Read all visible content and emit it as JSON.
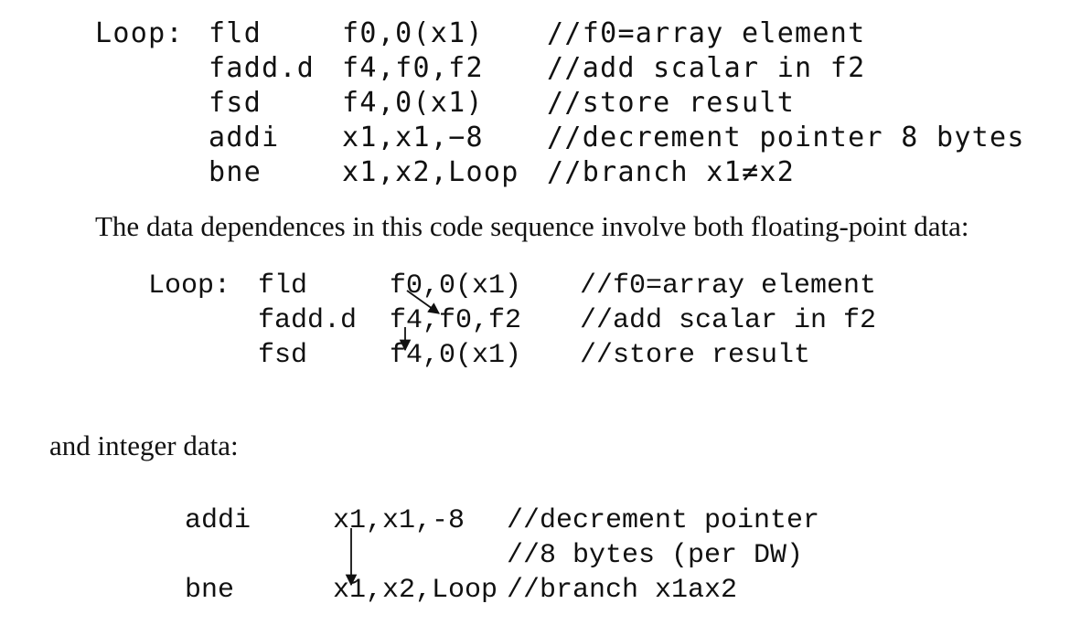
{
  "listing1": [
    {
      "label": "Loop:",
      "op": "fld",
      "args": "f0,0(x1)",
      "comment": "//f0=array element"
    },
    {
      "label": "",
      "op": "fadd.d",
      "args": "f4,f0,f2",
      "comment": "//add scalar in f2"
    },
    {
      "label": "",
      "op": "fsd",
      "args": "f4,0(x1)",
      "comment": "//store result"
    },
    {
      "label": "",
      "op": "addi",
      "args": "x1,x1,−8",
      "comment": "//decrement pointer 8 bytes"
    },
    {
      "label": "",
      "op": "bne",
      "args": "x1,x2,Loop",
      "comment": "//branch x1≠x2"
    }
  ],
  "sentence_fp": "The data dependences in this code sequence involve both floating-point data:",
  "listing2": [
    {
      "label": "Loop:",
      "op": "fld",
      "args": "f0,0(x1)",
      "comment": "//f0=array element"
    },
    {
      "label": "",
      "op": "fadd.d",
      "args": "f4,f0,f2",
      "comment": "//add scalar in f2"
    },
    {
      "label": "",
      "op": "fsd",
      "args": "f4,0(x1)",
      "comment": "//store result"
    }
  ],
  "sentence_int": "and integer data:",
  "listing3": [
    {
      "op": "addi",
      "args": "x1,x1,-8",
      "comment": "//decrement pointer"
    },
    {
      "op": "",
      "args": "",
      "comment": "//8 bytes (per DW)"
    },
    {
      "op": "bne",
      "args": "x1,x2,Loop",
      "comment": "//branch x1ax2"
    }
  ]
}
